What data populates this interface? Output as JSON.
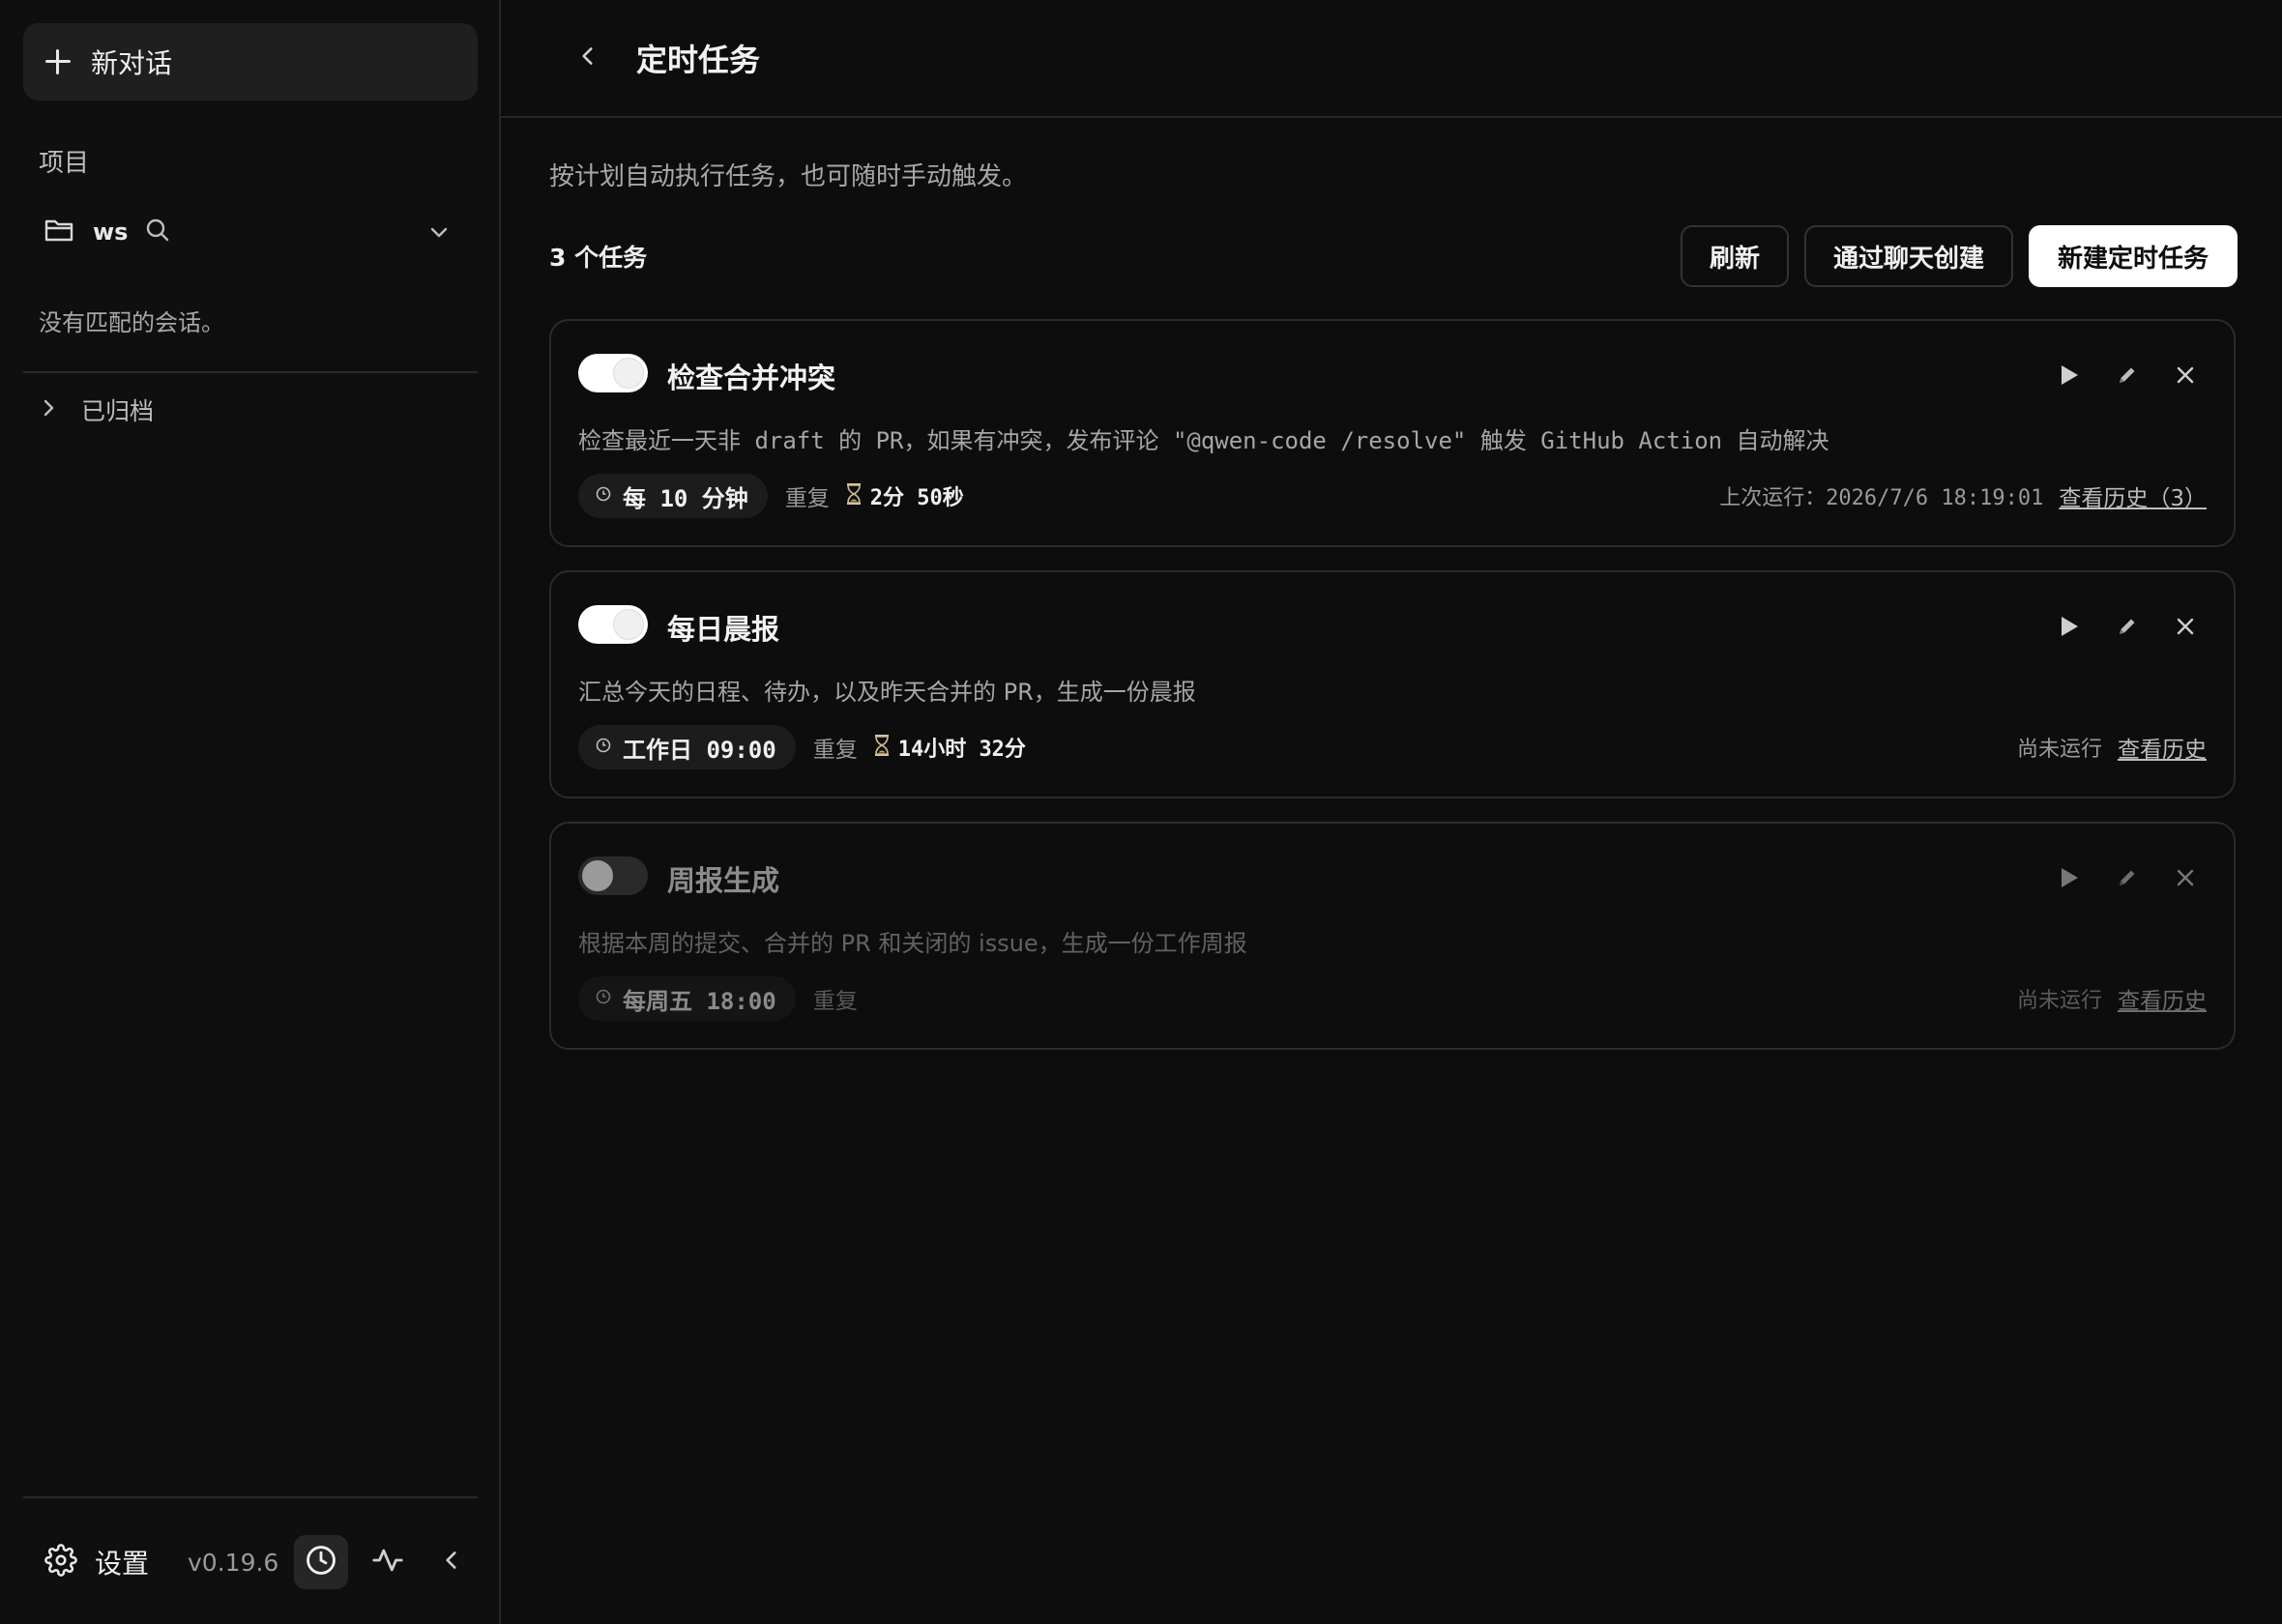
{
  "sidebar": {
    "new_chat_label": "新对话",
    "projects_title": "项目",
    "project_name": "ws",
    "empty_message": "没有匹配的会话。",
    "archived_label": "已归档",
    "settings_label": "设置",
    "version": "v0.19.6"
  },
  "header": {
    "title": "定时任务"
  },
  "main": {
    "subtitle": "按计划自动执行任务，也可随时手动触发。",
    "task_count": "3 个任务",
    "buttons": {
      "refresh": "刷新",
      "create_via_chat": "通过聊天创建",
      "new_task": "新建定时任务"
    }
  },
  "tasks": [
    {
      "name": "检查合并冲突",
      "enabled": true,
      "description": "检查最近一天非 draft 的 PR，如果有冲突，发布评论 \"@qwen-code /resolve\" 触发 GitHub Action 自动解决",
      "schedule": "每 10 分钟",
      "repeat": "重复",
      "countdown": "2分 50秒",
      "last_run": "上次运行：2026/7/6 18:19:01",
      "history": "查看历史（3）"
    },
    {
      "name": "每日晨报",
      "enabled": true,
      "description": "汇总今天的日程、待办，以及昨天合并的 PR，生成一份晨报",
      "schedule": "工作日 09:00",
      "repeat": "重复",
      "countdown": "14小时 32分",
      "last_run": "尚未运行",
      "history": "查看历史"
    },
    {
      "name": "周报生成",
      "enabled": false,
      "description": "根据本周的提交、合并的 PR 和关闭的 issue，生成一份工作周报",
      "schedule": "每周五 18:00",
      "repeat": "重复",
      "countdown": "",
      "last_run": "尚未运行",
      "history": "查看历史"
    }
  ],
  "colors": {
    "background": "#0d0d0d",
    "sidebar": "#0f0f0f",
    "primary_button": "#ffffff",
    "muted_text": "#9a9a9a"
  }
}
